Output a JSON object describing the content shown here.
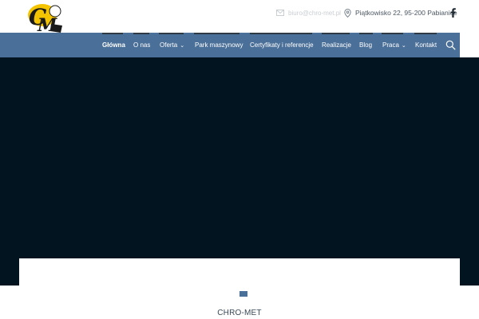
{
  "header": {
    "logo_icon": "chro-met-logo",
    "email": "biuro@chro-met.pl",
    "address": "Piątkowisko 22, 95-200 Pabianice",
    "social_icon": "facebook-icon"
  },
  "nav": {
    "items": [
      {
        "label": "Główna",
        "active": true
      },
      {
        "label": "O nas"
      },
      {
        "label": "Oferta",
        "dropdown": true
      },
      {
        "label": "Park maszynowy"
      },
      {
        "label": "Certyfikaty i referencje"
      },
      {
        "label": "Realizacje"
      },
      {
        "label": "Blog"
      },
      {
        "label": "Praca",
        "dropdown": true
      },
      {
        "label": "Kontakt"
      }
    ],
    "search_icon": "search-icon",
    "chevron": "⌄"
  },
  "hero": {
    "background_color": "#02141f",
    "slide_indicator_color": "#4a6f98"
  },
  "footer_label": "CHRO-MET",
  "colors": {
    "nav_background": "#4a6f98",
    "text_dark": "#3a4a58"
  }
}
